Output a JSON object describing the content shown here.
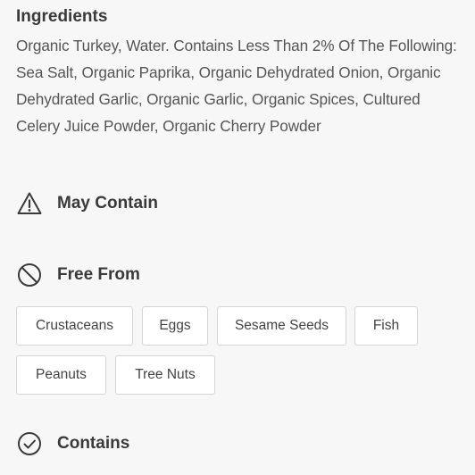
{
  "ingredients": {
    "title": "Ingredients",
    "text": "Organic Turkey, Water. Contains Less Than 2% Of The Following: Sea Salt, Organic Paprika, Organic Dehydrated Onion, Organic Dehydrated Garlic, Organic Garlic, Organic Spices, Cultured Celery Juice Powder, Organic Cherry Powder"
  },
  "may_contain": {
    "icon": "warning-triangle-icon",
    "label": "May Contain"
  },
  "free_from": {
    "icon": "prohibited-icon",
    "label": "Free From",
    "tags": [
      "Crustaceans",
      "Eggs",
      "Sesame Seeds",
      "Fish",
      "Peanuts",
      "Tree Nuts"
    ]
  },
  "contains": {
    "icon": "check-circle-icon",
    "label": "Contains"
  }
}
